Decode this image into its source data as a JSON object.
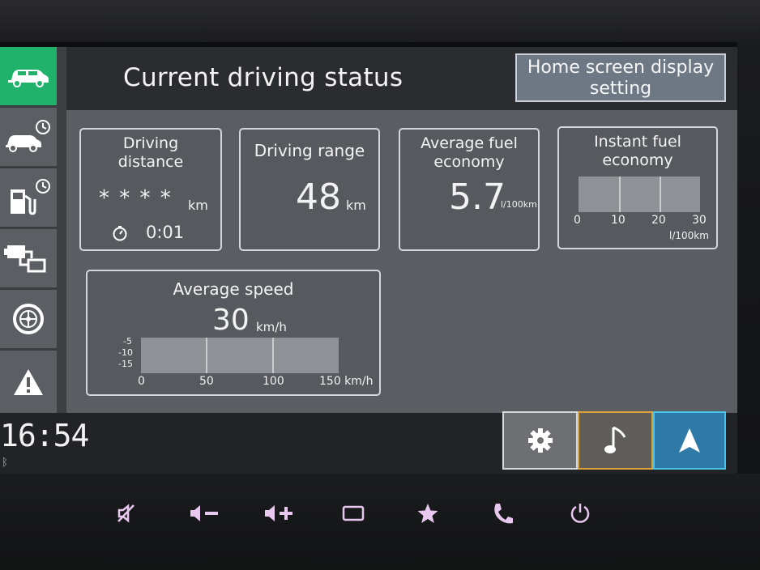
{
  "header": {
    "title": "Current driving status",
    "home_screen_button": "Home screen display setting"
  },
  "sidebar": {
    "items": [
      {
        "icon": "car-icon",
        "active": true
      },
      {
        "icon": "car-clock-icon",
        "active": false
      },
      {
        "icon": "fuel-clock-icon",
        "active": false
      },
      {
        "icon": "engine-transmission-icon",
        "active": false
      },
      {
        "icon": "tire-icon",
        "active": false
      },
      {
        "icon": "warning-icon",
        "active": false
      }
    ]
  },
  "cards": {
    "driving_distance": {
      "label_line1": "Driving",
      "label_line2": "distance",
      "value": "* * * *",
      "unit": "km",
      "timer_value": "0:01"
    },
    "driving_range": {
      "label": "Driving range",
      "value": "48",
      "unit": "km"
    },
    "average_fuel_economy": {
      "label_line1": "Average fuel",
      "label_line2": "economy",
      "value": "5.7",
      "unit": "l/100km"
    },
    "instant_fuel_economy": {
      "label_line1": "Instant fuel",
      "label_line2": "economy",
      "ticks": [
        "0",
        "10",
        "20",
        "30"
      ],
      "unit": "l/100km",
      "level": 0
    },
    "average_speed": {
      "label": "Average speed",
      "value": "30",
      "unit": "km/h",
      "y_ticks": [
        "-5",
        "-10",
        "-15"
      ],
      "x_ticks": [
        "0",
        "50",
        "100",
        "150 km/h"
      ],
      "level": 0
    }
  },
  "status": {
    "clock": "16:54",
    "bluetooth_icon": "bluetooth-icon"
  },
  "bottom_tabs": [
    {
      "name": "settings",
      "icon": "gear-icon",
      "border_color": "#d8d9db"
    },
    {
      "name": "music",
      "icon": "music-note-icon",
      "border_color": "#e2a23a"
    },
    {
      "name": "navigation",
      "icon": "navigation-arrow-icon",
      "border_color": "#49c4e6"
    }
  ],
  "hardware_buttons": [
    {
      "icon": "mute-icon",
      "symbol": "🔇"
    },
    {
      "icon": "volume-down-icon",
      "symbol": "◀−"
    },
    {
      "icon": "volume-up-icon",
      "symbol": "◀+"
    },
    {
      "icon": "screen-icon",
      "symbol": "▭"
    },
    {
      "icon": "favorite-star-icon",
      "symbol": "★"
    },
    {
      "icon": "phone-icon",
      "symbol": "✆"
    },
    {
      "icon": "power-icon",
      "symbol": "⏻"
    }
  ],
  "colors": {
    "accent_green": "#20b26b",
    "music_border": "#e2a23a",
    "nav_border": "#49c4e6"
  }
}
